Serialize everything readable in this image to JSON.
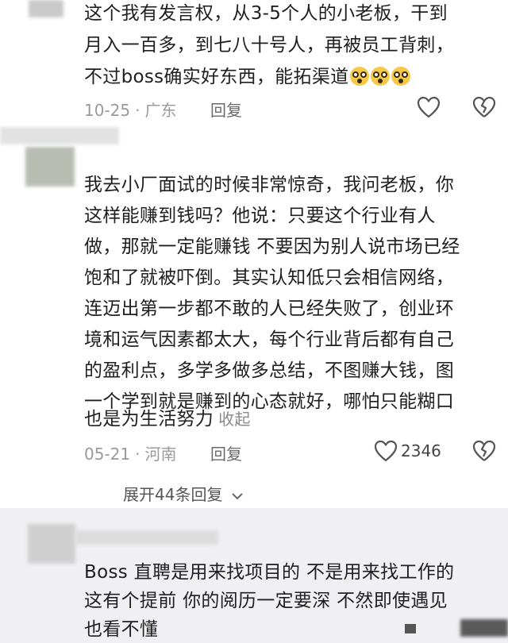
{
  "comments": [
    {
      "lines": [
        "这个我有发言权，从3-5个人的小老板，干到",
        "月入一百多，到七八十号人，再被员工背刺，",
        "不过boss确实好东西，能拓渠道"
      ],
      "emoji_count": 3,
      "date": "10-25",
      "location": "广东",
      "reply_label": "回复",
      "like_count": ""
    },
    {
      "lines": [
        "我去小厂面试的时候非常惊奇，我问老板，你",
        "这样能赚到钱吗？他说：只要这个行业有人",
        "做，那就一定能赚钱 不要因为别人说市场已经",
        "饱和了就被吓倒。其实认知低只会相信网络，",
        "连迈出第一步都不敢的人已经失败了，创业环",
        "境和运气因素都太大，每个行业背后都有自己",
        "的盈利点，多学多做多总结，不图赚大钱，图",
        "一个学到就是赚到的心态就好，哪怕只能糊口",
        "也是为生活努力"
      ],
      "collapse_label": "收起",
      "date": "05-21",
      "location": "河南",
      "reply_label": "回复",
      "like_count": "2346",
      "expand_label": "展开44条回复"
    },
    {
      "lines": [
        "Boss 直聘是用来找项目的 不是用来找工作的",
        "这有个提前 你的阅历一定要深 不然即使遇见",
        "也看不懂"
      ]
    }
  ],
  "colors": {
    "text": "#1f1f1f",
    "meta": "#9a9a9a",
    "band": "#f0f0f2"
  },
  "icons": [
    "heart-outline-icon",
    "broken-heart-icon",
    "chevron-down-icon",
    "emoji-dizzy-icon"
  ]
}
